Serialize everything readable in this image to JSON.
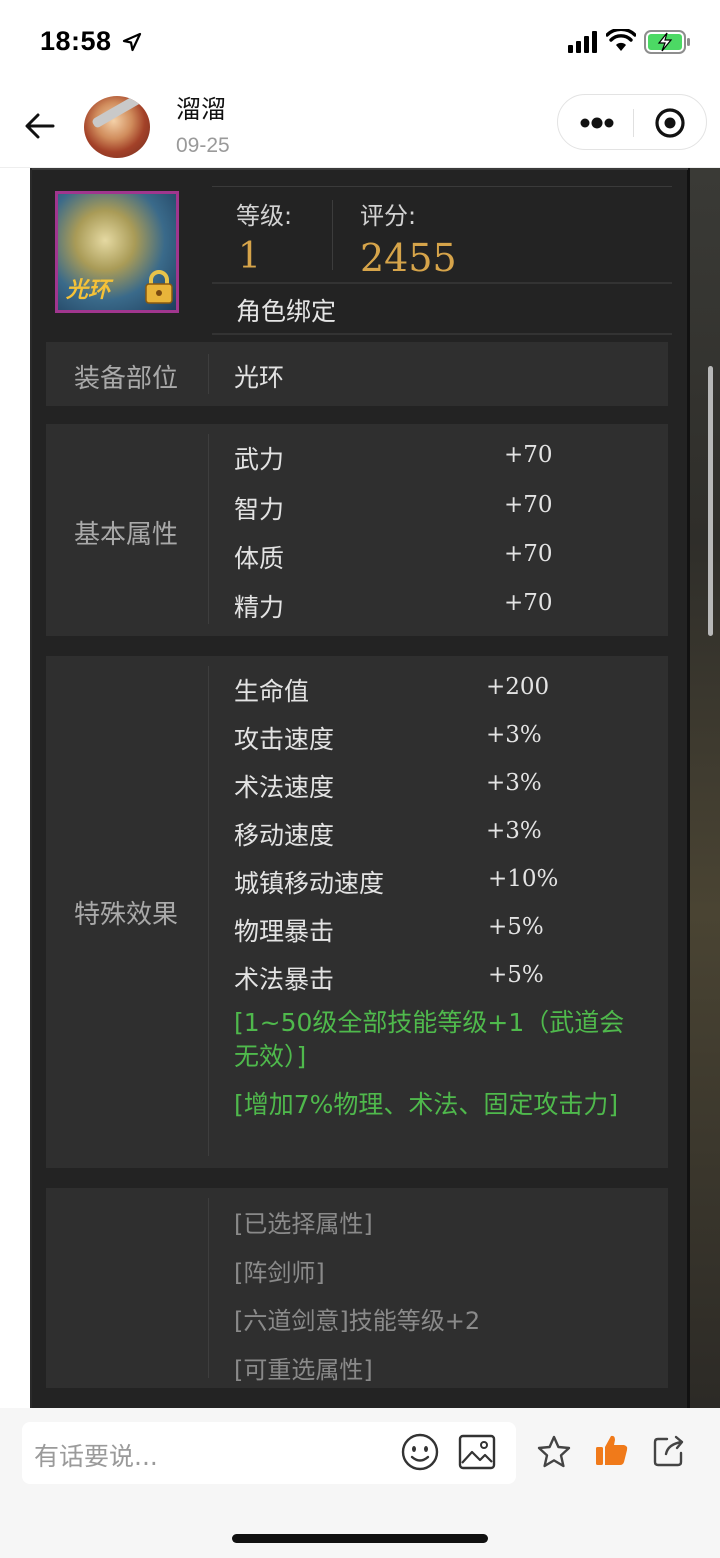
{
  "status_bar": {
    "time": "18:58"
  },
  "header": {
    "author": "溜溜",
    "date": "09-25"
  },
  "item": {
    "icon_label": "光环",
    "level_label": "等级:",
    "level_value": "1",
    "score_label": "评分:",
    "score_value": "2455",
    "bind_text": "角色绑定"
  },
  "slot": {
    "label": "装备部位",
    "value": "光环"
  },
  "basic_attrs": {
    "label": "基本属性",
    "rows": [
      {
        "name": "武力",
        "value": "+70"
      },
      {
        "name": "智力",
        "value": "+70"
      },
      {
        "name": "体质",
        "value": "+70"
      },
      {
        "name": "精力",
        "value": "+70"
      }
    ]
  },
  "special_effects": {
    "label": "特殊效果",
    "rows": [
      {
        "name": "生命值",
        "value": "+200"
      },
      {
        "name": "攻击速度",
        "value": "+3%"
      },
      {
        "name": "术法速度",
        "value": "+3%"
      },
      {
        "name": "移动速度",
        "value": "+3%"
      },
      {
        "name": "城镇移动速度",
        "value": "+10%"
      },
      {
        "name": "物理暴击",
        "value": "+5%"
      },
      {
        "name": "术法暴击",
        "value": "+5%"
      }
    ],
    "green_1": "[1~50级全部技能等级+1（武道会无效）]",
    "green_2": "[增加7%物理、术法、固定攻击力]"
  },
  "selected_attrs": [
    "[已选择属性]",
    "[阵剑师]",
    "[六道剑意]技能等级+2",
    "[可重选属性]"
  ],
  "bottom_bar": {
    "placeholder": "有话要说..."
  },
  "colors": {
    "gold": "#d6a44a",
    "green": "#4fb94c",
    "like": "#f07a1a"
  }
}
